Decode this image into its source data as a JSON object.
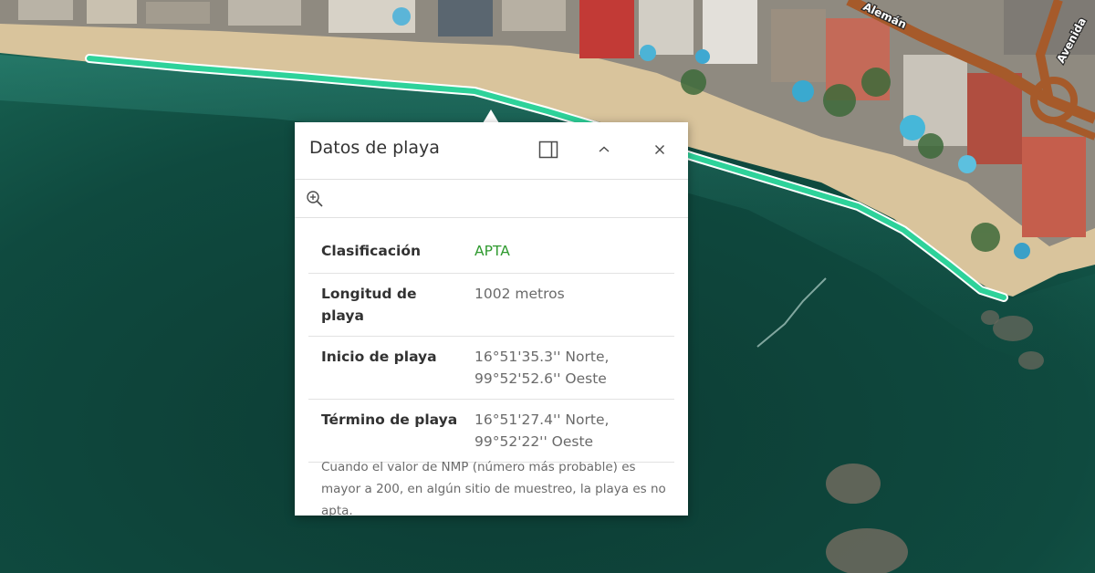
{
  "map": {
    "road_labels": {
      "aleman": "Alemán",
      "avenida": "Avenida"
    },
    "colors": {
      "sea_deep": "#0e3a32",
      "sea_mid": "#1a5a4c",
      "sand": "#d8c7a0",
      "beach_highlight": "#2ed29a"
    }
  },
  "popup": {
    "title": "Datos de playa",
    "icons": {
      "dock": "dock-icon",
      "collapse": "chevron-up-icon",
      "close": "close-icon",
      "zoom": "zoom-to-icon"
    },
    "fields": [
      {
        "label": "Clasificación",
        "value": "APTA"
      },
      {
        "label": "Longitud de playa",
        "value": "1002 metros"
      },
      {
        "label": "Inicio de playa",
        "value": "16°51'35.3'' Norte, 99°52'52.6'' Oeste"
      },
      {
        "label": "Término de playa",
        "value": "16°51'27.4'' Norte, 99°52'22'' Oeste"
      }
    ],
    "note": "Cuando el valor de NMP (número más probable) es mayor a 200, en algún sitio de muestreo, la playa es no apta."
  }
}
